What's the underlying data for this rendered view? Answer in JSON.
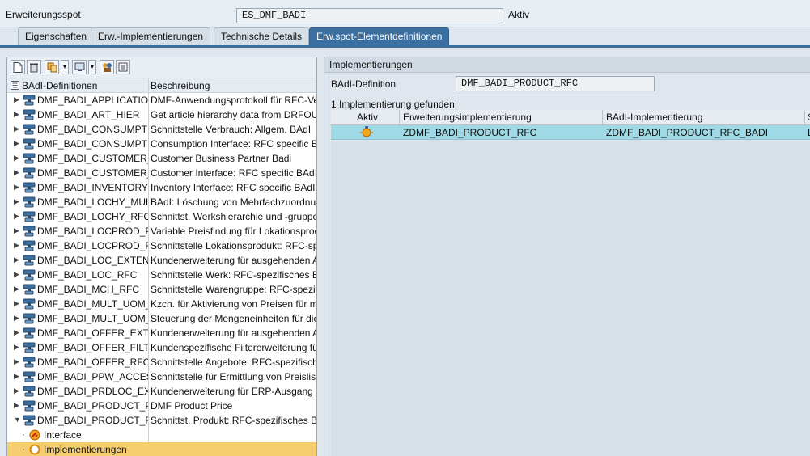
{
  "spot": {
    "label": "Erweiterungsspot",
    "value": "ES_DMF_BADI",
    "status": "Aktiv"
  },
  "tabs": [
    {
      "label": "Eigenschaften"
    },
    {
      "label": "Erw.-Implementierungen"
    },
    {
      "label": "Technische Details"
    },
    {
      "label": "Erw.spot-Elementdefinitionen"
    }
  ],
  "toolbar_icons": [
    "new-icon",
    "delete-icon",
    "copy-icon",
    "display-icon",
    "dropdown-icon",
    "filter-icon",
    "dropdown-icon",
    "list-icon"
  ],
  "tree": {
    "headers": {
      "name": "BAdI-Definitionen",
      "desc": "Beschreibung"
    },
    "rows": [
      {
        "name": "DMF_BADI_APPLICATIO",
        "desc": "DMF-Anwendungsprotokoll für RFC-Verb"
      },
      {
        "name": "DMF_BADI_ART_HIER",
        "desc": "Get article hierarchy data from DRFOUT"
      },
      {
        "name": "DMF_BADI_CONSUMPTI",
        "desc": "Schnittstelle Verbrauch: Allgem. BAdI"
      },
      {
        "name": "DMF_BADI_CONSUMPTI",
        "desc": "Consumption Interface: RFC specific BA"
      },
      {
        "name": "DMF_BADI_CUSTOMER_",
        "desc": "Customer Business Partner Badi"
      },
      {
        "name": "DMF_BADI_CUSTOMER_",
        "desc": "Customer Interface: RFC specific BAdI"
      },
      {
        "name": "DMF_BADI_INVENTORY",
        "desc": "Inventory Interface: RFC specific BAdI"
      },
      {
        "name": "DMF_BADI_LOCHY_MUL",
        "desc": "BAdI: Löschung von Mehrfachzuordnur"
      },
      {
        "name": "DMF_BADI_LOCHY_RFC",
        "desc": "Schnittst. Werkshierarchie und -gruppe"
      },
      {
        "name": "DMF_BADI_LOCPROD_PI",
        "desc": "Variable Preisfindung für Lokationsprodu"
      },
      {
        "name": "DMF_BADI_LOCPROD_RI",
        "desc": "Schnittstelle Lokationsprodukt: RFC-spez"
      },
      {
        "name": "DMF_BADI_LOC_EXTENS",
        "desc": "Kundenerweiterung für ausgehenden Au"
      },
      {
        "name": "DMF_BADI_LOC_RFC",
        "desc": "Schnittstelle Werk: RFC-spezifisches BA"
      },
      {
        "name": "DMF_BADI_MCH_RFC",
        "desc": "Schnittstelle Warengruppe: RFC-spezifis"
      },
      {
        "name": "DMF_BADI_MULT_UOM_",
        "desc": "Kzch. für Aktivierung von Preisen für m"
      },
      {
        "name": "DMF_BADI_MULT_UOM_",
        "desc": "Steuerung der Mengeneinheiten für die"
      },
      {
        "name": "DMF_BADI_OFFER_EXTE",
        "desc": "Kundenerweiterung für ausgehenden Au"
      },
      {
        "name": "DMF_BADI_OFFER_FILT",
        "desc": "Kundenspezifische Filtererweiterung für"
      },
      {
        "name": "DMF_BADI_OFFER_RFC",
        "desc": "Schnittstelle Angebote: RFC-spezifisches"
      },
      {
        "name": "DMF_BADI_PPW_ACCESS",
        "desc": "Schnittstelle für Ermittlung von Preisliste"
      },
      {
        "name": "DMF_BADI_PRDLOC_EXT",
        "desc": "Kundenerweiterung für ERP-Ausgang zu"
      },
      {
        "name": "DMF_BADI_PRODUCT_P",
        "desc": "DMF Product Price"
      },
      {
        "name": "DMF_BADI_PRODUCT_R",
        "desc": "Schnittst. Produkt: RFC-spezifisches BA"
      }
    ],
    "children": [
      {
        "name": "Interface",
        "desc": ""
      },
      {
        "name": "Implementierungen",
        "desc": ""
      }
    ]
  },
  "right": {
    "title": "Implementierungen",
    "def_label": "BAdI-Definition",
    "def_value": "DMF_BADI_PRODUCT_RFC",
    "found": "1  Implementierung gefunden",
    "columns": [
      "Aktiv",
      "Erweiterungsimplementierung",
      "BAdI-Implementierung",
      "S"
    ],
    "rows": [
      {
        "impl": "ZDMF_BADI_PRODUCT_RFC",
        "badi_impl": "ZDMF_BADI_PRODUCT_RFC_BADI",
        "s": "L"
      }
    ]
  },
  "colors": {
    "accent": "#3a6f9f",
    "selected_row": "#f5cc6e",
    "grid_highlight": "#9fd9e6"
  }
}
